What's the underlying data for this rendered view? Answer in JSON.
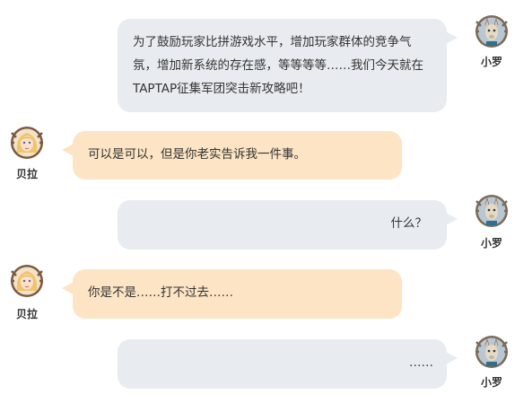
{
  "speakers": {
    "xiaoluo": {
      "name": "小罗",
      "avatar_icon": "llama-avatar-icon",
      "bubble_color": "#e8ecf0"
    },
    "beila": {
      "name": "贝拉",
      "avatar_icon": "blonde-girl-avatar-icon",
      "bubble_color": "#fde4c4"
    }
  },
  "messages": [
    {
      "speaker": "小罗",
      "side": "right",
      "text": "为了鼓励玩家比拼游戏水平，增加玩家群体的竞争气氛，增加新系统的存在感，等等等等……我们今天就在TAPTAP征集军团突击新攻略吧！"
    },
    {
      "speaker": "贝拉",
      "side": "left",
      "text": "可以是可以，但是你老实告诉我一件事。"
    },
    {
      "speaker": "小罗",
      "side": "right",
      "text": "什么？"
    },
    {
      "speaker": "贝拉",
      "side": "left",
      "text": "你是不是……打不过去……"
    },
    {
      "speaker": "小罗",
      "side": "right",
      "text": "……"
    }
  ]
}
